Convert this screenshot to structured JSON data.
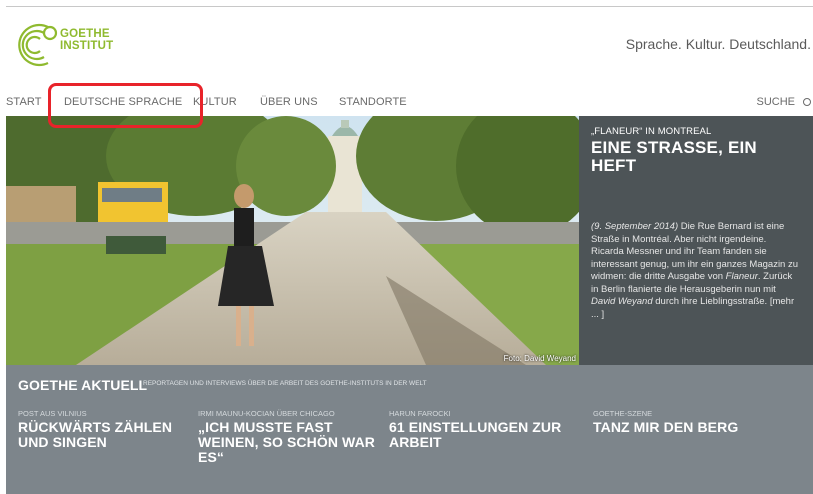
{
  "brand": {
    "logo_line1": "GOETHE",
    "logo_line2": "INSTITUT",
    "tagline": "Sprache. Kultur. Deutschland.",
    "brand_color": "#8fba2f"
  },
  "nav": {
    "items": [
      "START",
      "DEUTSCHE SPRACHE",
      "KULTUR",
      "ÜBER UNS",
      "STANDORTE"
    ],
    "search_label": "SUCHE",
    "search_icon": "search-icon",
    "highlight_color": "#e8232a"
  },
  "hero": {
    "photo_credit": "Foto: David Weyand"
  },
  "teaser": {
    "kicker": "„FLANEUR“ IN MONTREAL",
    "headline": "EINE STRASSE, EIN HEFT",
    "date": "(9. September 2014)",
    "text1": " Die Rue Bernard ist eine Straße in Montréal. Aber nicht irgendeine. Ricarda Messner und ihr Team fanden sie interessant genug, um ihr ein ganzes Magazin zu widmen: die dritte Ausgabe von ",
    "magazine": "Flaneur",
    "text2": ". Zurück in Berlin flanierte die Herausgeberin nun mit ",
    "person": "David Weyand",
    "text3": " durch ihre Lieblingsstraße. [mehr ... ]",
    "bg_color": "#4d5457"
  },
  "aktuell": {
    "title": "GOETHE AKTUELL",
    "subtitle": "REPORTAGEN UND INTERVIEWS ÜBER DIE ARBEIT DES GOETHE-INSTITUTS IN DER WELT",
    "bg_color": "#7d858b",
    "items": [
      {
        "kicker": "POST AUS VILNIUS",
        "headline": "RÜCKWÄRTS ZÄHLEN UND SINGEN"
      },
      {
        "kicker": "IRMI MAUNU-KOCIAN ÜBER CHICAGO",
        "headline": "„ICH MUSSTE FAST WEINEN, SO SCHÖN WAR ES“"
      },
      {
        "kicker": "HARUN FAROCKI",
        "headline": "61 EINSTELLUNGEN ZUR ARBEIT"
      },
      {
        "kicker": "GOETHE-SZENE",
        "headline": "TANZ MIR DEN BERG"
      }
    ]
  }
}
